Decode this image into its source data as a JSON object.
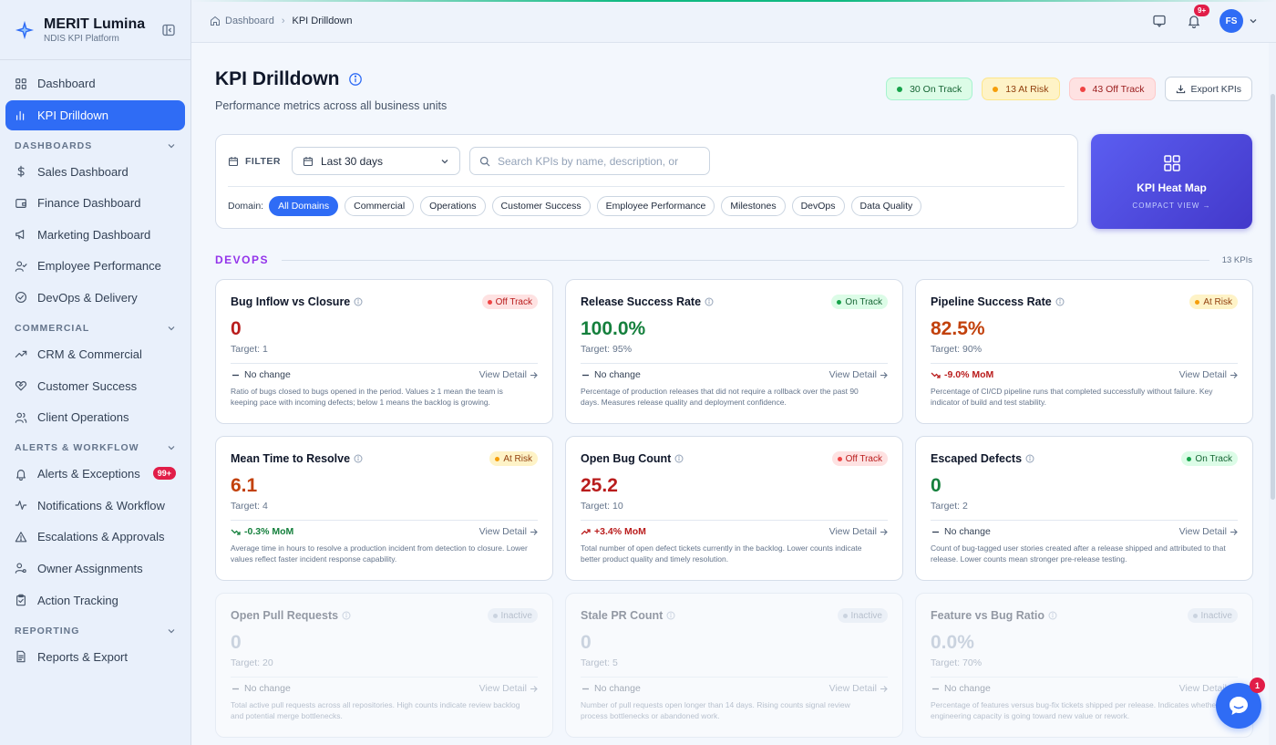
{
  "brand": {
    "name": "MERIT Lumina",
    "subtitle": "NDIS KPI Platform"
  },
  "sidebar": {
    "top_items": [
      {
        "label": "Dashboard",
        "icon": "grid-icon"
      },
      {
        "label": "KPI Drilldown",
        "icon": "bar-chart-icon",
        "active": true
      }
    ],
    "sections": [
      {
        "title": "DASHBOARDS",
        "items": [
          {
            "label": "Sales Dashboard",
            "icon": "dollar-icon"
          },
          {
            "label": "Finance Dashboard",
            "icon": "wallet-icon"
          },
          {
            "label": "Marketing Dashboard",
            "icon": "megaphone-icon"
          },
          {
            "label": "Employee Performance",
            "icon": "user-check-icon"
          },
          {
            "label": "DevOps & Delivery",
            "icon": "check-circle-icon"
          }
        ]
      },
      {
        "title": "COMMERCIAL",
        "items": [
          {
            "label": "CRM & Commercial",
            "icon": "trending-up-icon"
          },
          {
            "label": "Customer Success",
            "icon": "heart-handshake-icon"
          },
          {
            "label": "Client Operations",
            "icon": "users-icon"
          }
        ]
      },
      {
        "title": "ALERTS & WORKFLOW",
        "items": [
          {
            "label": "Alerts & Exceptions",
            "icon": "bell-icon",
            "badge": "99+"
          },
          {
            "label": "Notifications & Workflow",
            "icon": "activity-icon"
          },
          {
            "label": "Escalations & Approvals",
            "icon": "alert-triangle-icon"
          },
          {
            "label": "Owner Assignments",
            "icon": "user-cog-icon"
          },
          {
            "label": "Action Tracking",
            "icon": "clipboard-check-icon"
          }
        ]
      },
      {
        "title": "REPORTING",
        "items": [
          {
            "label": "Reports & Export",
            "icon": "file-text-icon"
          }
        ]
      }
    ]
  },
  "topbar": {
    "breadcrumb_home": "Dashboard",
    "breadcrumb_current": "KPI Drilldown",
    "notif_badge": "9+",
    "avatar_initials": "FS"
  },
  "page": {
    "title": "KPI Drilldown",
    "subtitle": "Performance metrics across all business units",
    "on_track": "30 On Track",
    "at_risk": "13 At Risk",
    "off_track": "43 Off Track",
    "export_label": "Export KPIs"
  },
  "filter": {
    "label": "FILTER",
    "period": "Last 30 days",
    "search_placeholder": "Search KPIs by name, description, or",
    "domain_label": "Domain:",
    "domains": [
      "All Domains",
      "Commercial",
      "Operations",
      "Customer Success",
      "Employee Performance",
      "Milestones",
      "DevOps",
      "Data Quality"
    ],
    "active_domain": "All Domains"
  },
  "heatmap": {
    "title": "KPI Heat Map",
    "subtitle": "COMPACT VIEW →"
  },
  "group": {
    "title": "DEVOPS",
    "count": "13 KPIs"
  },
  "kpis": [
    {
      "title": "Bug Inflow vs Closure",
      "status": "Off Track",
      "status_kind": "off",
      "value": "0",
      "value_color": "red",
      "target": "Target: 1",
      "trend": "No change",
      "trend_kind": "none",
      "view": "View Detail",
      "desc": "Ratio of bugs closed to bugs opened in the period. Values ≥ 1 mean the team is keeping pace with incoming defects; below 1 means the backlog is growing."
    },
    {
      "title": "Release Success Rate",
      "status": "On Track",
      "status_kind": "on",
      "value": "100.0%",
      "value_color": "green",
      "target": "Target: 95%",
      "trend": "No change",
      "trend_kind": "none",
      "view": "View Detail",
      "desc": "Percentage of production releases that did not require a rollback over the past 90 days. Measures release quality and deployment confidence."
    },
    {
      "title": "Pipeline Success Rate",
      "status": "At Risk",
      "status_kind": "risk",
      "value": "82.5%",
      "value_color": "amber",
      "target": "Target: 90%",
      "trend": "-9.0% MoM",
      "trend_kind": "down-red",
      "view": "View Detail",
      "desc": "Percentage of CI/CD pipeline runs that completed successfully without failure. Key indicator of build and test stability."
    },
    {
      "title": "Mean Time to Resolve",
      "status": "At Risk",
      "status_kind": "risk",
      "value": "6.1",
      "value_color": "amber",
      "target": "Target: 4",
      "trend": "-0.3% MoM",
      "trend_kind": "down-green",
      "view": "View Detail",
      "desc": "Average time in hours to resolve a production incident from detection to closure. Lower values reflect faster incident response capability."
    },
    {
      "title": "Open Bug Count",
      "status": "Off Track",
      "status_kind": "off",
      "value": "25.2",
      "value_color": "red",
      "target": "Target: 10",
      "trend": "+3.4% MoM",
      "trend_kind": "up-red",
      "view": "View Detail",
      "desc": "Total number of open defect tickets currently in the backlog. Lower counts indicate better product quality and timely resolution."
    },
    {
      "title": "Escaped Defects",
      "status": "On Track",
      "status_kind": "on",
      "value": "0",
      "value_color": "green",
      "target": "Target: 2",
      "trend": "No change",
      "trend_kind": "none",
      "view": "View Detail",
      "desc": "Count of bug-tagged user stories created after a release shipped and attributed to that release. Lower counts mean stronger pre-release testing."
    },
    {
      "title": "Open Pull Requests",
      "status": "Inactive",
      "status_kind": "in",
      "value": "0",
      "value_color": "grey",
      "target": "Target: 20",
      "trend": "No change",
      "trend_kind": "none",
      "view": "View Detail",
      "desc": "Total active pull requests across all repositories. High counts indicate review backlog and potential merge bottlenecks."
    },
    {
      "title": "Stale PR Count",
      "status": "Inactive",
      "status_kind": "in",
      "value": "0",
      "value_color": "grey",
      "target": "Target: 5",
      "trend": "No change",
      "trend_kind": "none",
      "view": "View Detail",
      "desc": "Number of pull requests open longer than 14 days. Rising counts signal review process bottlenecks or abandoned work."
    },
    {
      "title": "Feature vs Bug Ratio",
      "status": "Inactive",
      "status_kind": "in",
      "value": "0.0%",
      "value_color": "grey",
      "target": "Target: 70%",
      "trend": "No change",
      "trend_kind": "none",
      "view": "View Detail",
      "desc": "Percentage of features versus bug-fix tickets shipped per release. Indicates whether engineering capacity is going toward new value or rework."
    }
  ],
  "chat": {
    "badge": "1"
  }
}
